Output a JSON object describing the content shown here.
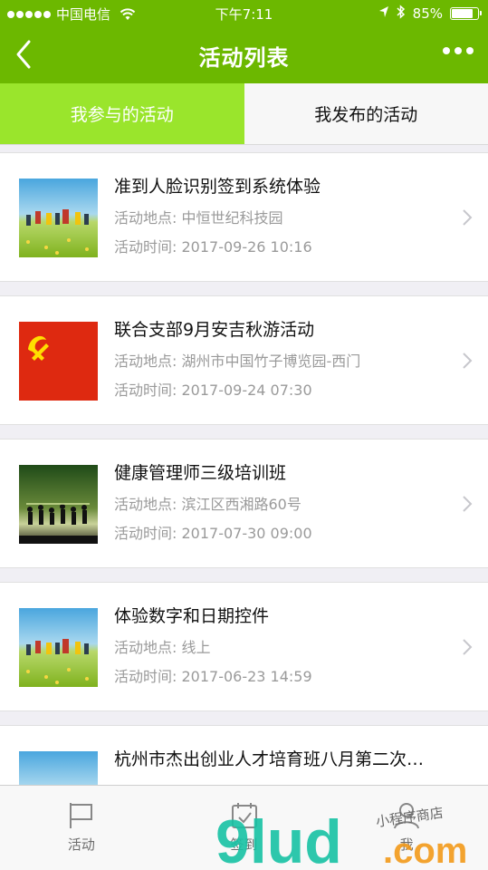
{
  "status_bar": {
    "carrier": "中国电信",
    "time": "下午7:11",
    "battery_percent": "85%",
    "battery_level": 0.85
  },
  "nav": {
    "title": "活动列表",
    "icons": [
      "back-chevron-icon",
      "more-dots-icon"
    ]
  },
  "tabs": [
    {
      "label": "我参与的活动",
      "active": true
    },
    {
      "label": "我发布的活动",
      "active": false
    }
  ],
  "activities": [
    {
      "name": "准到人脸识别签到系统体验",
      "location": "活动地点: 中恒世纪科技园",
      "time": "活动时间: 2017-09-26 10:16",
      "thumb": "kids-field-photo"
    },
    {
      "name": "联合支部9月安吉秋游活动",
      "location": "活动地点: 湖州市中国竹子博览园-西门",
      "time": "活动时间: 2017-09-24 07:30",
      "thumb": "party-flag"
    },
    {
      "name": "健康管理师三级培训班",
      "location": "活动地点: 滨江区西湘路60号",
      "time": "活动时间: 2017-07-30 09:00",
      "thumb": "silhouette-jump-photo"
    },
    {
      "name": "体验数字和日期控件",
      "location": "活动地点: 线上",
      "time": "活动时间: 2017-06-23 14:59",
      "thumb": "kids-field-photo"
    },
    {
      "name": "杭州市杰出创业人才培育班八月第二次…",
      "location": "",
      "time": "",
      "thumb": "kids-field-photo"
    }
  ],
  "tabbar": [
    {
      "label": "活动",
      "icon": "flag-icon"
    },
    {
      "label": "签到",
      "icon": "calendar-check-icon"
    },
    {
      "label": "我",
      "icon": "person-icon"
    }
  ],
  "watermark": {
    "main": "9lud",
    "suffix": ".com",
    "script": "小程序商店"
  },
  "colors": {
    "brand_green": "#6cb800",
    "tab_active": "#9ae52c",
    "watermark_teal": "#18c2a4",
    "watermark_orange": "#f39a1a"
  }
}
